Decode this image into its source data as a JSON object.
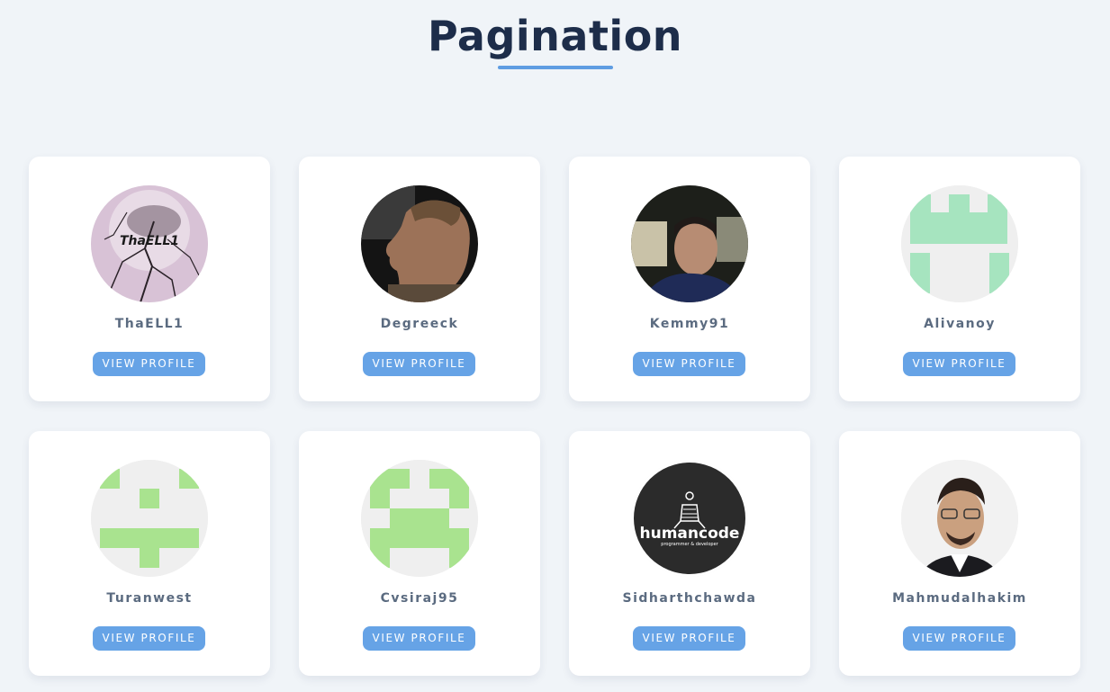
{
  "page": {
    "title": "Pagination"
  },
  "profiles": [
    {
      "name": "ThaELL1",
      "button": "VIEW PROFILE",
      "avatar_text": "ThaELL1"
    },
    {
      "name": "Degreeck",
      "button": "VIEW PROFILE"
    },
    {
      "name": "Kemmy91",
      "button": "VIEW PROFILE"
    },
    {
      "name": "Alivanoy",
      "button": "VIEW PROFILE"
    },
    {
      "name": "Turanwest",
      "button": "VIEW PROFILE"
    },
    {
      "name": "Cvsiraj95",
      "button": "VIEW PROFILE"
    },
    {
      "name": "Sidharthchawda",
      "button": "VIEW PROFILE",
      "avatar_text": "humancode",
      "avatar_subtext": "programmer & developer"
    },
    {
      "name": "Mahmudalhakim",
      "button": "VIEW PROFILE"
    }
  ],
  "colors": {
    "background": "#f0f4f8",
    "title": "#1d2d4a",
    "accent": "#5f9de2",
    "button": "#66a3e6",
    "identicon_teal": "#a6e4bf",
    "identicon_green": "#a9e38f"
  }
}
